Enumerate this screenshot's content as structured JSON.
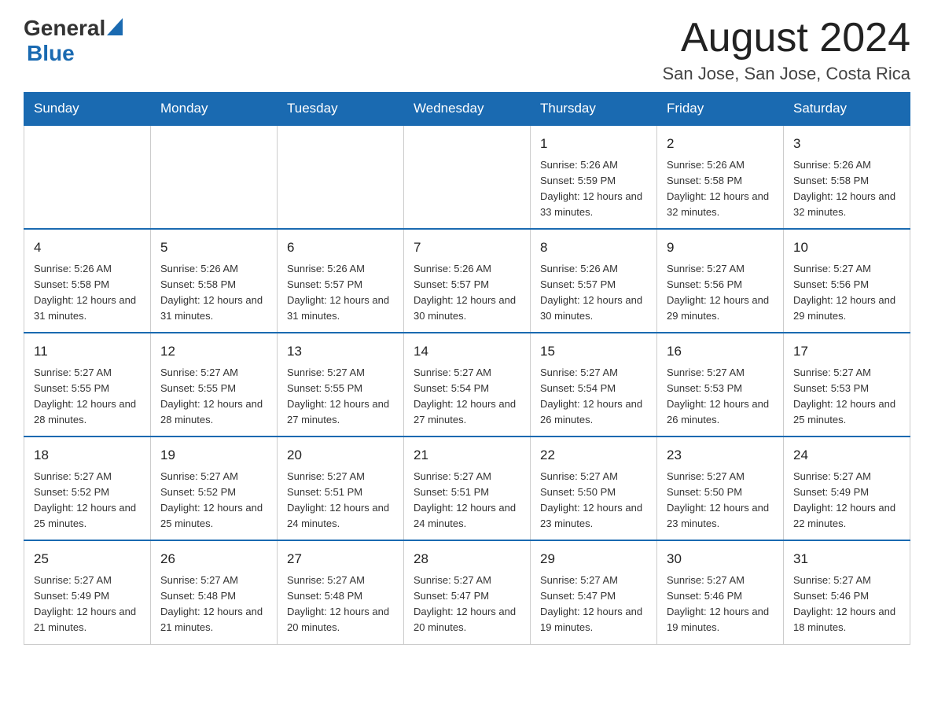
{
  "header": {
    "logo_general": "General",
    "logo_blue": "Blue",
    "month_title": "August 2024",
    "location": "San Jose, San Jose, Costa Rica"
  },
  "days_of_week": [
    "Sunday",
    "Monday",
    "Tuesday",
    "Wednesday",
    "Thursday",
    "Friday",
    "Saturday"
  ],
  "weeks": [
    [
      {
        "day": "",
        "info": ""
      },
      {
        "day": "",
        "info": ""
      },
      {
        "day": "",
        "info": ""
      },
      {
        "day": "",
        "info": ""
      },
      {
        "day": "1",
        "info": "Sunrise: 5:26 AM\nSunset: 5:59 PM\nDaylight: 12 hours and 33 minutes."
      },
      {
        "day": "2",
        "info": "Sunrise: 5:26 AM\nSunset: 5:58 PM\nDaylight: 12 hours and 32 minutes."
      },
      {
        "day": "3",
        "info": "Sunrise: 5:26 AM\nSunset: 5:58 PM\nDaylight: 12 hours and 32 minutes."
      }
    ],
    [
      {
        "day": "4",
        "info": "Sunrise: 5:26 AM\nSunset: 5:58 PM\nDaylight: 12 hours and 31 minutes."
      },
      {
        "day": "5",
        "info": "Sunrise: 5:26 AM\nSunset: 5:58 PM\nDaylight: 12 hours and 31 minutes."
      },
      {
        "day": "6",
        "info": "Sunrise: 5:26 AM\nSunset: 5:57 PM\nDaylight: 12 hours and 31 minutes."
      },
      {
        "day": "7",
        "info": "Sunrise: 5:26 AM\nSunset: 5:57 PM\nDaylight: 12 hours and 30 minutes."
      },
      {
        "day": "8",
        "info": "Sunrise: 5:26 AM\nSunset: 5:57 PM\nDaylight: 12 hours and 30 minutes."
      },
      {
        "day": "9",
        "info": "Sunrise: 5:27 AM\nSunset: 5:56 PM\nDaylight: 12 hours and 29 minutes."
      },
      {
        "day": "10",
        "info": "Sunrise: 5:27 AM\nSunset: 5:56 PM\nDaylight: 12 hours and 29 minutes."
      }
    ],
    [
      {
        "day": "11",
        "info": "Sunrise: 5:27 AM\nSunset: 5:55 PM\nDaylight: 12 hours and 28 minutes."
      },
      {
        "day": "12",
        "info": "Sunrise: 5:27 AM\nSunset: 5:55 PM\nDaylight: 12 hours and 28 minutes."
      },
      {
        "day": "13",
        "info": "Sunrise: 5:27 AM\nSunset: 5:55 PM\nDaylight: 12 hours and 27 minutes."
      },
      {
        "day": "14",
        "info": "Sunrise: 5:27 AM\nSunset: 5:54 PM\nDaylight: 12 hours and 27 minutes."
      },
      {
        "day": "15",
        "info": "Sunrise: 5:27 AM\nSunset: 5:54 PM\nDaylight: 12 hours and 26 minutes."
      },
      {
        "day": "16",
        "info": "Sunrise: 5:27 AM\nSunset: 5:53 PM\nDaylight: 12 hours and 26 minutes."
      },
      {
        "day": "17",
        "info": "Sunrise: 5:27 AM\nSunset: 5:53 PM\nDaylight: 12 hours and 25 minutes."
      }
    ],
    [
      {
        "day": "18",
        "info": "Sunrise: 5:27 AM\nSunset: 5:52 PM\nDaylight: 12 hours and 25 minutes."
      },
      {
        "day": "19",
        "info": "Sunrise: 5:27 AM\nSunset: 5:52 PM\nDaylight: 12 hours and 25 minutes."
      },
      {
        "day": "20",
        "info": "Sunrise: 5:27 AM\nSunset: 5:51 PM\nDaylight: 12 hours and 24 minutes."
      },
      {
        "day": "21",
        "info": "Sunrise: 5:27 AM\nSunset: 5:51 PM\nDaylight: 12 hours and 24 minutes."
      },
      {
        "day": "22",
        "info": "Sunrise: 5:27 AM\nSunset: 5:50 PM\nDaylight: 12 hours and 23 minutes."
      },
      {
        "day": "23",
        "info": "Sunrise: 5:27 AM\nSunset: 5:50 PM\nDaylight: 12 hours and 23 minutes."
      },
      {
        "day": "24",
        "info": "Sunrise: 5:27 AM\nSunset: 5:49 PM\nDaylight: 12 hours and 22 minutes."
      }
    ],
    [
      {
        "day": "25",
        "info": "Sunrise: 5:27 AM\nSunset: 5:49 PM\nDaylight: 12 hours and 21 minutes."
      },
      {
        "day": "26",
        "info": "Sunrise: 5:27 AM\nSunset: 5:48 PM\nDaylight: 12 hours and 21 minutes."
      },
      {
        "day": "27",
        "info": "Sunrise: 5:27 AM\nSunset: 5:48 PM\nDaylight: 12 hours and 20 minutes."
      },
      {
        "day": "28",
        "info": "Sunrise: 5:27 AM\nSunset: 5:47 PM\nDaylight: 12 hours and 20 minutes."
      },
      {
        "day": "29",
        "info": "Sunrise: 5:27 AM\nSunset: 5:47 PM\nDaylight: 12 hours and 19 minutes."
      },
      {
        "day": "30",
        "info": "Sunrise: 5:27 AM\nSunset: 5:46 PM\nDaylight: 12 hours and 19 minutes."
      },
      {
        "day": "31",
        "info": "Sunrise: 5:27 AM\nSunset: 5:46 PM\nDaylight: 12 hours and 18 minutes."
      }
    ]
  ]
}
